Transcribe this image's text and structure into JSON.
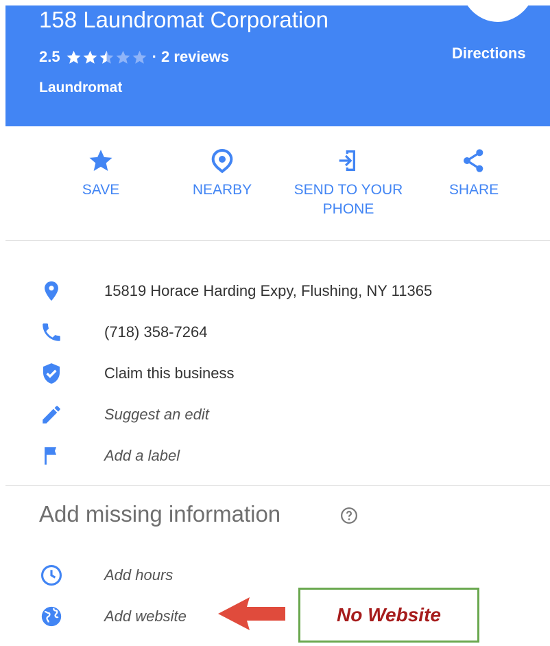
{
  "place": {
    "title": "158 Laundromat Corporation",
    "rating": "2.5",
    "rating_value": 2.5,
    "rating_max": 5,
    "reviews": "· 2 reviews",
    "category": "Laundromat",
    "directions_label": "Directions"
  },
  "actions": [
    {
      "label": "SAVE",
      "icon": "star-icon"
    },
    {
      "label": "NEARBY",
      "icon": "nearby-icon"
    },
    {
      "label_line1": "SEND TO YOUR",
      "label_line2": "PHONE",
      "icon": "send-to-phone-icon"
    },
    {
      "label": "SHARE",
      "icon": "share-icon"
    }
  ],
  "details": {
    "address": "15819 Horace Harding Expy, Flushing, NY 11365",
    "phone": "(718) 358-7264",
    "claim": "Claim this business",
    "suggest_edit": "Suggest an edit",
    "add_label": "Add a label"
  },
  "missing": {
    "title": "Add missing information",
    "add_hours": "Add hours",
    "add_website": "Add website"
  },
  "annotation": {
    "callout": "No Website"
  },
  "colors": {
    "header_blue": "#4285f4",
    "icon_blue": "#4285f4",
    "callout_border": "#6aa84f",
    "callout_text": "#a61c1c",
    "arrow": "#e04b3c"
  }
}
